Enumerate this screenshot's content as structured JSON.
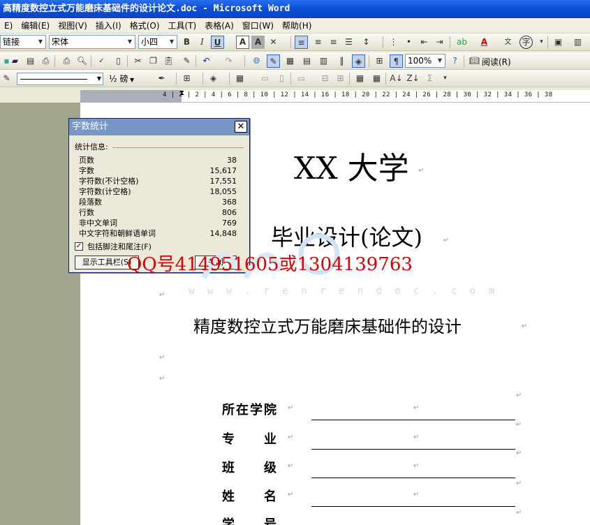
{
  "window": {
    "title": "高精度数控立式万能磨床基础件的设计论文.doc - Microsoft Word"
  },
  "menu": [
    "E)",
    "编辑(E)",
    "视图(V)",
    "插入(I)",
    "格式(O)",
    "工具(T)",
    "表格(A)",
    "窗口(W)",
    "帮助(H)"
  ],
  "toolbar": {
    "style_value": "链接",
    "font_value": "宋体",
    "size_value": "小四",
    "zoom_value": "100%",
    "read_label": "阅读(R)",
    "line_weight": "½ 磅"
  },
  "ruler": {
    "ticks": "4 | 2 | 2 | 4 | 6 | 8 | 10 | 12 | 14 | 16 | 18 | 20 | 22 | 24 | 26 | 28 | 30 | 32 | 34 | 36 | 38"
  },
  "dialog": {
    "title": "字数统计",
    "group_label": "统计信息:",
    "stats": [
      {
        "label": "页数",
        "value": "38"
      },
      {
        "label": "字数",
        "value": "15,617"
      },
      {
        "label": "字符数(不计空格)",
        "value": "17,551"
      },
      {
        "label": "字符数(计空格)",
        "value": "18,055"
      },
      {
        "label": "段落数",
        "value": "368"
      },
      {
        "label": "行数",
        "value": "806"
      },
      {
        "label": "非中文单词",
        "value": "769"
      },
      {
        "label": "中文字符和朝鲜语单词",
        "value": "14,848"
      }
    ],
    "include_footnotes_label": "包括脚注和尾注(F)",
    "include_footnotes_checked": true,
    "show_toolbar_button": "显示工具栏(S)",
    "close_button": "关闭"
  },
  "document": {
    "university": "XX 大学",
    "thesis_type": "毕业设计(论文)",
    "topic": "精度数控立式万能磨床基础件的设计",
    "fields": [
      "所在学院",
      "专　　业",
      "班　　级",
      "姓　　名",
      "学　　号"
    ],
    "paragraph_mark": "↵"
  },
  "watermark": {
    "contact": "QQ号414951605或1304139763",
    "url": "w w w . r e n r e n d o c . c o m"
  }
}
